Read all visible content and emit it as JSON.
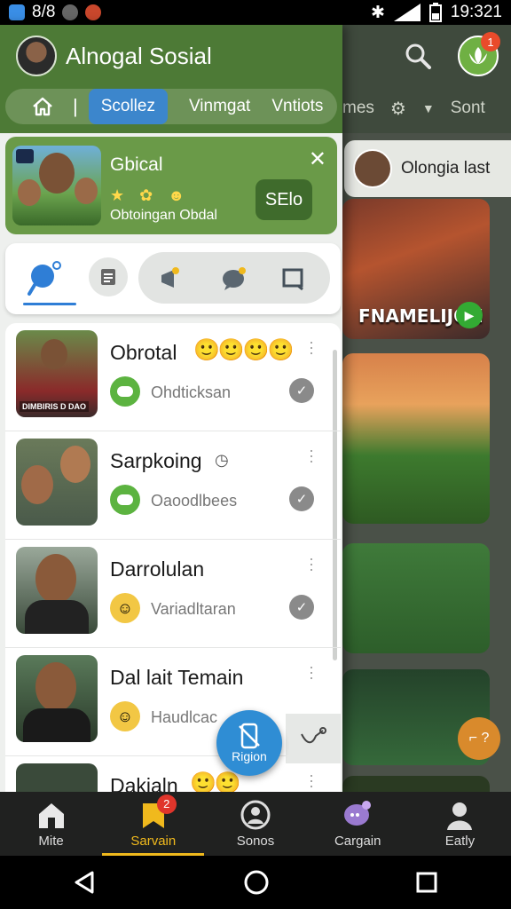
{
  "status_bar": {
    "notif_count": "8/8",
    "time": "19:321"
  },
  "drawer": {
    "title": "Alnogal Sosial",
    "nav": {
      "divider": "|",
      "active_tab": "Scollez",
      "tabs": [
        "Vinmgat",
        "Vntiots"
      ]
    }
  },
  "background": {
    "tabs": [
      "mes",
      "Sont"
    ],
    "badge_count": "1",
    "chip_label": "Olongia last",
    "card1_text": "FNAMELIJON"
  },
  "group_card": {
    "title": "Gbical",
    "subtitle": "Obtoingan Obdal",
    "button_label": "SElo"
  },
  "chats": [
    {
      "name": "Obrotal",
      "sub": "Ohdticksan",
      "thumb_caption": "DIMBIRIS D DAO"
    },
    {
      "name": "Sarpkoing",
      "sub": "Oaoodlbees"
    },
    {
      "name": "Darrolulan",
      "sub": "Variadltaran"
    },
    {
      "name": "Dal lait Temain",
      "sub": "Haudlcac"
    },
    {
      "name": "Dakialn"
    }
  ],
  "fab": {
    "label": "Rigion"
  },
  "bottom_nav": [
    {
      "label": "Mite",
      "icon": "home-icon"
    },
    {
      "label": "Sarvain",
      "icon": "bookmark-icon",
      "badge": "2"
    },
    {
      "label": "Sonos",
      "icon": "profile-icon"
    },
    {
      "label": "Cargain",
      "icon": "chat-bubble-icon"
    },
    {
      "label": "Eatly",
      "icon": "person-icon"
    }
  ],
  "colors": {
    "accent_green": "#4d7a36",
    "active_blue": "#3c86cc",
    "nav_active": "#f0b91d",
    "badge_red": "#e0352b"
  }
}
